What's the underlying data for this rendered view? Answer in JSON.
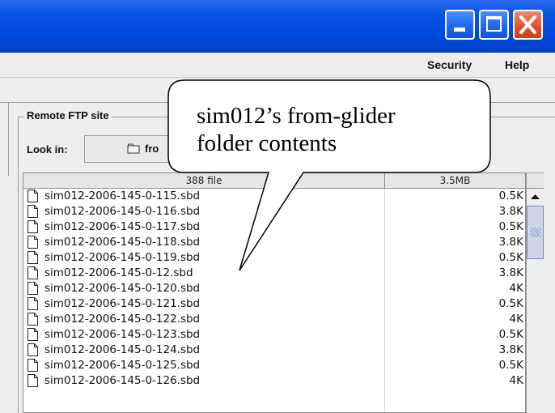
{
  "menubar": {
    "items": [
      "Security",
      "Help"
    ]
  },
  "remote_panel": {
    "group_label": "Remote FTP site",
    "look_in_label": "Look in:",
    "look_in_value": "fro"
  },
  "file_table": {
    "header_name": "388 file",
    "header_size": "3.5MB",
    "rows": [
      {
        "name": "sim012-2006-145-0-115.sbd",
        "size": "0.5K"
      },
      {
        "name": "sim012-2006-145-0-116.sbd",
        "size": "3.8K"
      },
      {
        "name": "sim012-2006-145-0-117.sbd",
        "size": "0.5K"
      },
      {
        "name": "sim012-2006-145-0-118.sbd",
        "size": "3.8K"
      },
      {
        "name": "sim012-2006-145-0-119.sbd",
        "size": "0.5K"
      },
      {
        "name": "sim012-2006-145-0-12.sbd",
        "size": "3.8K"
      },
      {
        "name": "sim012-2006-145-0-120.sbd",
        "size": "4K"
      },
      {
        "name": "sim012-2006-145-0-121.sbd",
        "size": "0.5K"
      },
      {
        "name": "sim012-2006-145-0-122.sbd",
        "size": "4K"
      },
      {
        "name": "sim012-2006-145-0-123.sbd",
        "size": "0.5K"
      },
      {
        "name": "sim012-2006-145-0-124.sbd",
        "size": "3.8K"
      },
      {
        "name": "sim012-2006-145-0-125.sbd",
        "size": "0.5K"
      },
      {
        "name": "sim012-2006-145-0-126.sbd",
        "size": "4K"
      }
    ]
  },
  "callout": {
    "line1": "sim012’s from-glider",
    "line2": "folder contents"
  },
  "icons": {
    "minimize": "minimize-icon",
    "maximize": "maximize-icon",
    "close": "close-icon",
    "folder": "folder-icon",
    "file": "file-icon",
    "scroll_up": "arrow-up-icon"
  },
  "colors": {
    "titlebar": "#0a54e6",
    "close_button": "#e0502b",
    "scroll_thumb": "#cfd6ea"
  }
}
